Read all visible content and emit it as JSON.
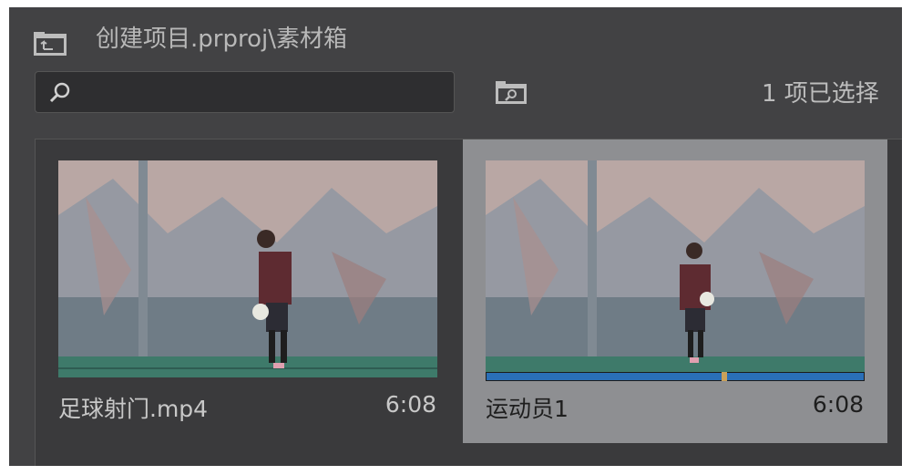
{
  "header": {
    "title": "创建项目.prproj\\素材箱",
    "up_icon": "folder-up-icon",
    "find_icon": "find-in-folder-icon"
  },
  "search": {
    "icon": "search-icon",
    "value": "",
    "placeholder": ""
  },
  "status": {
    "selection_count": "1 项已选择"
  },
  "items": [
    {
      "name": "足球射门.mp4",
      "duration": "6:08",
      "selected": false,
      "thumbnail": "soccer-player-thumbnail"
    },
    {
      "name": "运动员1",
      "duration": "6:08",
      "selected": true,
      "thumbnail": "soccer-player-thumbnail",
      "playhead_fraction": 0.63
    }
  ],
  "colors": {
    "panel_bg": "#424244",
    "selected_tile_bg": "#8e8f92",
    "progress_bar": "#2a6fb8",
    "text_light": "#c8c8c8",
    "text_dark": "#1e1e1e"
  }
}
